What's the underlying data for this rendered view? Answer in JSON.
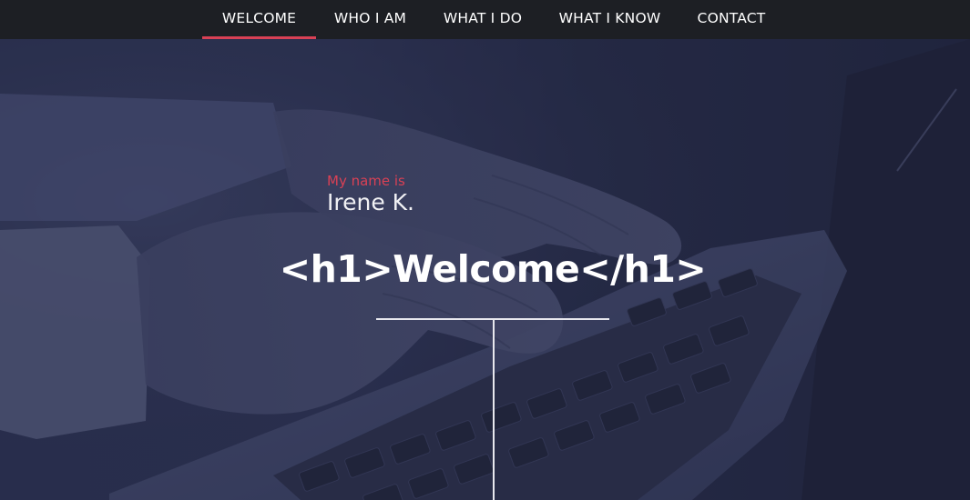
{
  "nav": {
    "items": [
      {
        "label": "WELCOME",
        "active": true
      },
      {
        "label": "WHO I AM",
        "active": false
      },
      {
        "label": "WHAT I DO",
        "active": false
      },
      {
        "label": "WHAT I KNOW",
        "active": false
      },
      {
        "label": "CONTACT",
        "active": false
      }
    ],
    "accent_color": "#d94155"
  },
  "hero": {
    "intro_label": "My name is",
    "name": "Irene K.",
    "title": "<h1>Welcome</h1>",
    "overlay_color": "#2a2f4f"
  }
}
